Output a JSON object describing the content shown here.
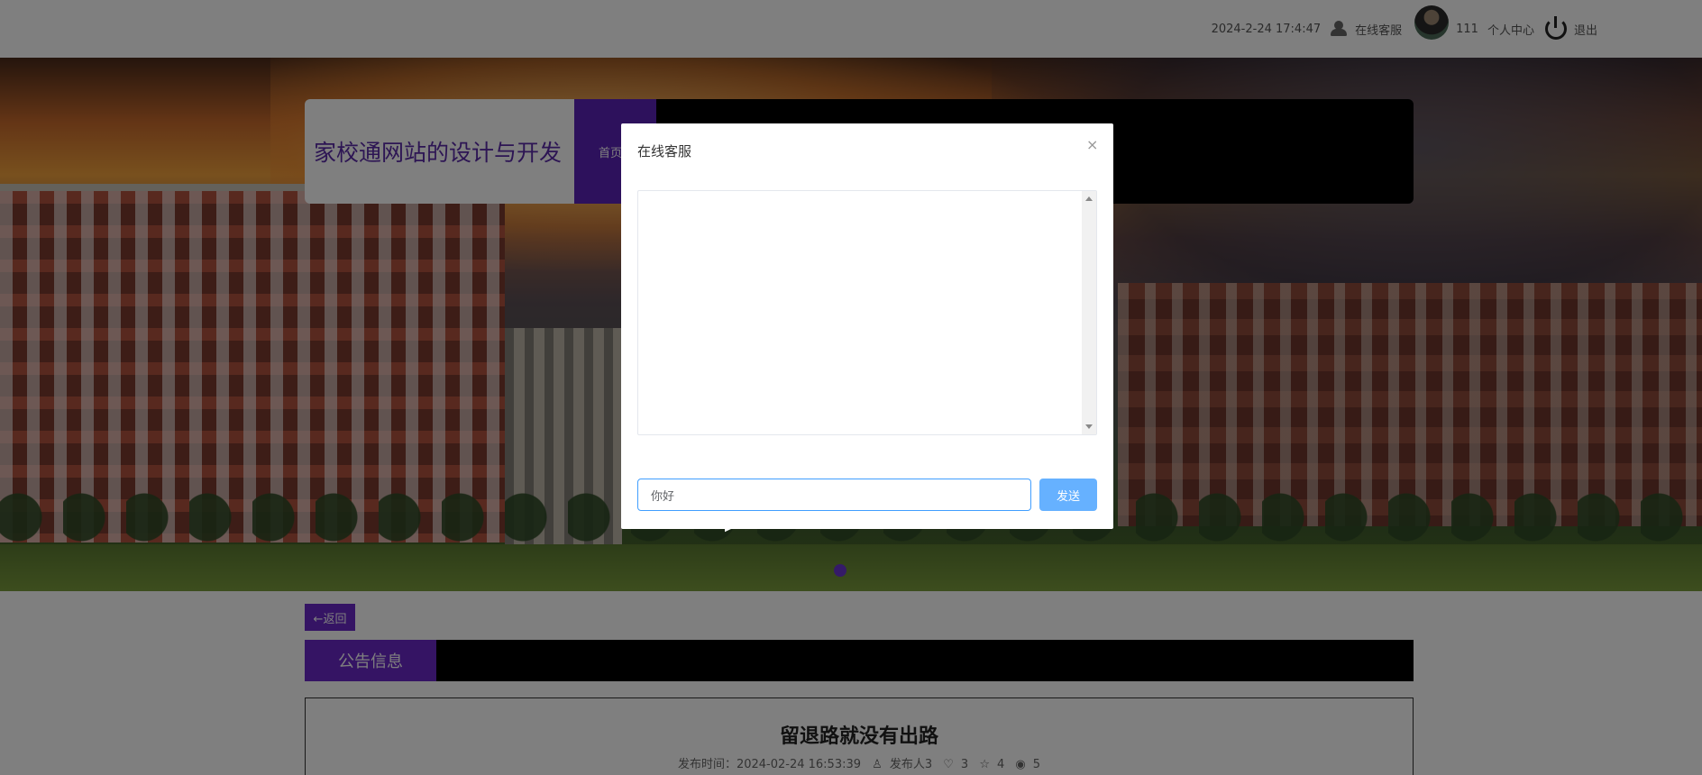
{
  "topbar": {
    "datetime": "2024-2-24 17:4:47",
    "customer_service": "在线客服",
    "username": "111",
    "user_center": "个人中心",
    "logout": "退出"
  },
  "header": {
    "site_title": "家校通网站的设计与开发",
    "nav_active_label": "首页"
  },
  "page": {
    "back_label": "←返回",
    "section_title": "公告信息",
    "article_title": "留退路就没有出路",
    "meta": {
      "publish_time": "发布时间：2024-02-24 16:53:39",
      "publisher": "发布人3",
      "likes": "3",
      "favorites": "4",
      "views": "5"
    }
  },
  "modal": {
    "title": "在线客服",
    "close": "×",
    "input_value": "你好",
    "send_label": "发送"
  },
  "colors": {
    "accent_purple": "#6a28c8",
    "send_blue": "#66b1ff",
    "input_focus": "#409eff"
  }
}
